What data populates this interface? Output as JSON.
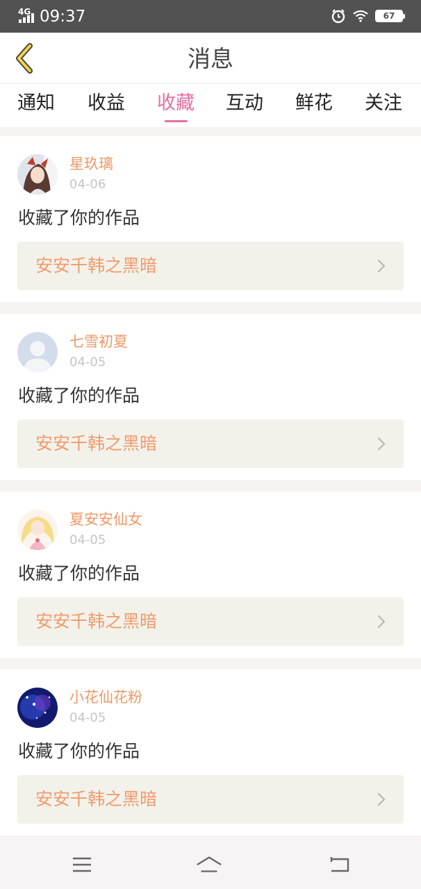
{
  "status_bar": {
    "network": "4G",
    "time": "09:37",
    "battery": "67",
    "icons": [
      "signal-icon",
      "alarm-icon",
      "wifi-icon",
      "battery-icon"
    ]
  },
  "header": {
    "title": "消息",
    "back_icon": "chevron-left-icon"
  },
  "tabs": [
    {
      "label": "通知",
      "active": false
    },
    {
      "label": "收益",
      "active": false
    },
    {
      "label": "收藏",
      "active": true
    },
    {
      "label": "互动",
      "active": false
    },
    {
      "label": "鲜花",
      "active": false
    },
    {
      "label": "关注",
      "active": false
    }
  ],
  "messages": [
    {
      "username": "星玖璃",
      "date": "04-06",
      "action": "收藏了你的作品",
      "work_title": "安安千韩之黑暗"
    },
    {
      "username": "七雪初夏",
      "date": "04-05",
      "action": "收藏了你的作品",
      "work_title": "安安千韩之黑暗"
    },
    {
      "username": "夏安安仙女",
      "date": "04-05",
      "action": "收藏了你的作品",
      "work_title": "安安千韩之黑暗"
    },
    {
      "username": "小花仙花粉",
      "date": "04-05",
      "action": "收藏了你的作品",
      "work_title": "安安千韩之黑暗"
    }
  ],
  "nav_bar": {
    "icons": [
      "menu-icon",
      "home-icon",
      "back-icon"
    ]
  },
  "colors": {
    "accent": "#e46ea4",
    "username": "#ef9866",
    "work_title": "#ef9b6e",
    "status_bar": "#525252"
  }
}
